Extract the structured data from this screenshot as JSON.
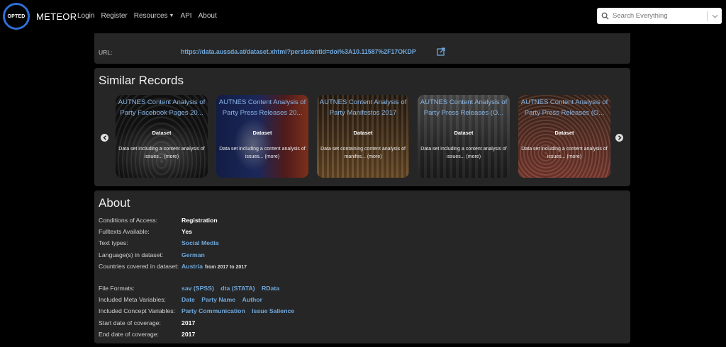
{
  "navbar": {
    "logo_text": "OPTED",
    "brand": "METEOR",
    "items": [
      {
        "label": "Login"
      },
      {
        "label": "Register"
      },
      {
        "label": "Resources",
        "has_caret": true
      },
      {
        "label": "API"
      },
      {
        "label": "About"
      }
    ],
    "search_placeholder": "Search Everything"
  },
  "url_panel": {
    "label": "URL:",
    "link": "https://data.aussda.at/dataset.xhtml?persistentId=doi%3A10.11587%2F17OKDP"
  },
  "similar": {
    "title": "Similar Records",
    "cards": [
      {
        "title": "AUTNES Content Analysis of Party Facebook Pages 20...",
        "type": "Dataset",
        "desc": "Data set including a content analysis of issues... (more)",
        "image": "parliament-hall"
      },
      {
        "title": "AUTNES Content Analysis of Party Press Releases 20...",
        "type": "Dataset",
        "desc": "Data set including a content analysis of issues... (more)",
        "image": "press-conference"
      },
      {
        "title": "AUTNES Content Analysis of Party Manifestos 2017",
        "type": "Dataset",
        "desc": "Data set containing content analysis of manifes... (more)",
        "image": "parliament-chamber"
      },
      {
        "title": "AUTNES Content Analysis of Party Press Releases (O...",
        "type": "Dataset",
        "desc": "Data set including a content analysis of issues... (more)",
        "image": "street-protest"
      },
      {
        "title": "AUTNES Content Analysis of Party Press Releases (O...",
        "type": "Dataset",
        "desc": "Data set including a content analysis of issues... (more)",
        "image": "crowd"
      }
    ]
  },
  "about": {
    "title": "About",
    "conditions_label": "Conditions of Access:",
    "conditions_value": "Registration",
    "fulltexts_label": "Fulltexts Available:",
    "fulltexts_value": "Yes",
    "text_types_label": "Text types:",
    "text_types_value": "Social Media",
    "languages_label": "Language(s) in dataset:",
    "languages_value": "German",
    "countries_label": "Countries covered in dataset:",
    "countries_value": "Austria",
    "countries_range": "from 2017 to 2017",
    "formats_label": "File Formats:",
    "formats": [
      "sav (SPSS)",
      "dta (STATA)",
      "RData"
    ],
    "meta_label": "Included Meta Variables:",
    "meta": [
      "Date",
      "Party Name",
      "Author"
    ],
    "concept_label": "Included Concept Variables:",
    "concepts": [
      "Party Communication",
      "Issue Salience"
    ],
    "start_label": "Start date of coverage:",
    "start_value": "2017",
    "end_label": "End date of coverage:",
    "end_value": "2017"
  }
}
